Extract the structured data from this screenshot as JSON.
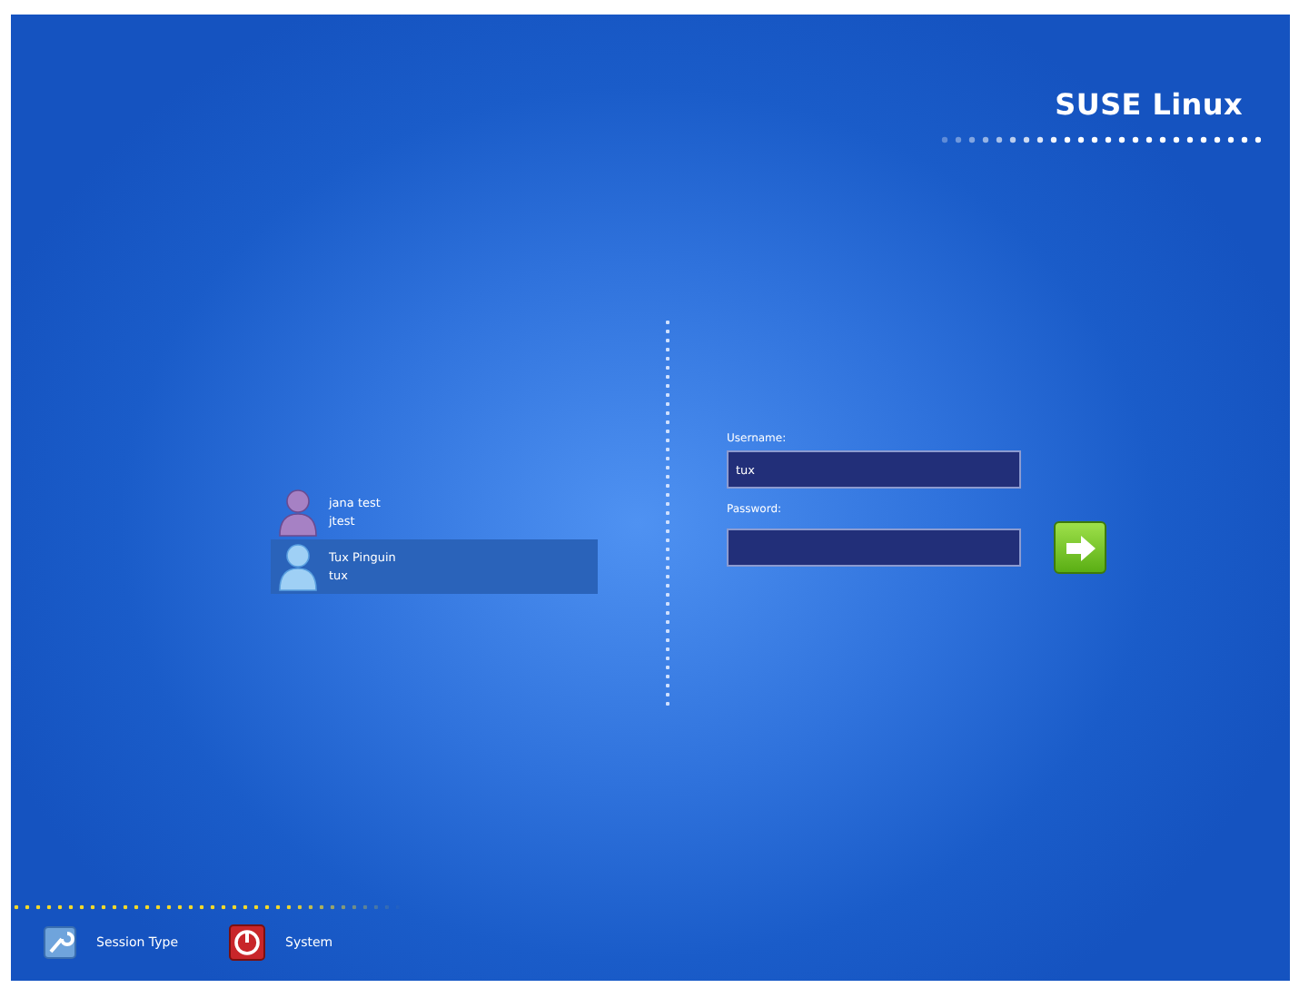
{
  "logo": {
    "text": "SUSE Linux"
  },
  "users": [
    {
      "name": "jana test",
      "login": "jtest",
      "selected": false
    },
    {
      "name": "Tux Pinguin",
      "login": "tux",
      "selected": true
    }
  ],
  "login_form": {
    "username_label": "Username:",
    "username_value": "tux",
    "password_label": "Password:"
  },
  "footer": [
    {
      "kind": "session",
      "label": "Session Type"
    },
    {
      "kind": "system",
      "label": "System"
    }
  ]
}
